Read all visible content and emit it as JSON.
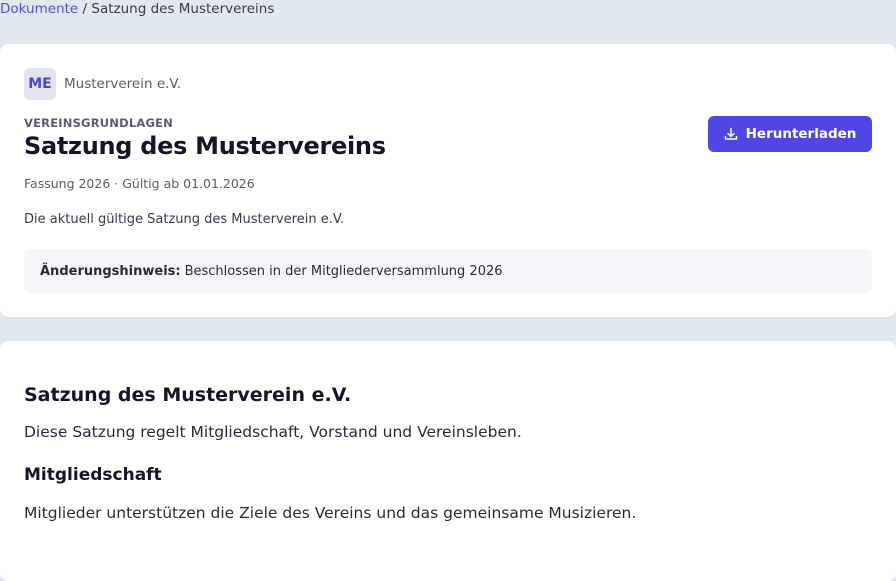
{
  "breadcrumb": {
    "parent": "Dokumente",
    "separator": " / ",
    "current": "Satzung des Mustervereins"
  },
  "org": {
    "initials": "ME",
    "name": "Musterverein e.V."
  },
  "document": {
    "category": "VEREINSGRUNDLAGEN",
    "title": "Satzung des Mustervereins",
    "meta": "Fassung 2026 · Gültig ab 01.01.2026",
    "description": "Die aktuell gültige Satzung des Musterverein e.V.",
    "notice_label": "Änderungshinweis:",
    "notice_text": "Beschlossen in der Mitgliederversammlung 2026"
  },
  "actions": {
    "download_label": "Herunterladen",
    "download_icon": "download-icon"
  },
  "content": {
    "heading": "Satzung des Musterverein e.V.",
    "intro": "Diese Satzung regelt Mitgliedschaft, Vorstand und Vereinsleben.",
    "section_heading": "Mitgliedschaft",
    "section_text": "Mitglieder unterstützen die Ziele des Vereins und das gemeinsame Musizieren."
  },
  "colors": {
    "accent": "#4f46e5",
    "link": "#5b4ddb",
    "background": "#e2e8f0"
  }
}
